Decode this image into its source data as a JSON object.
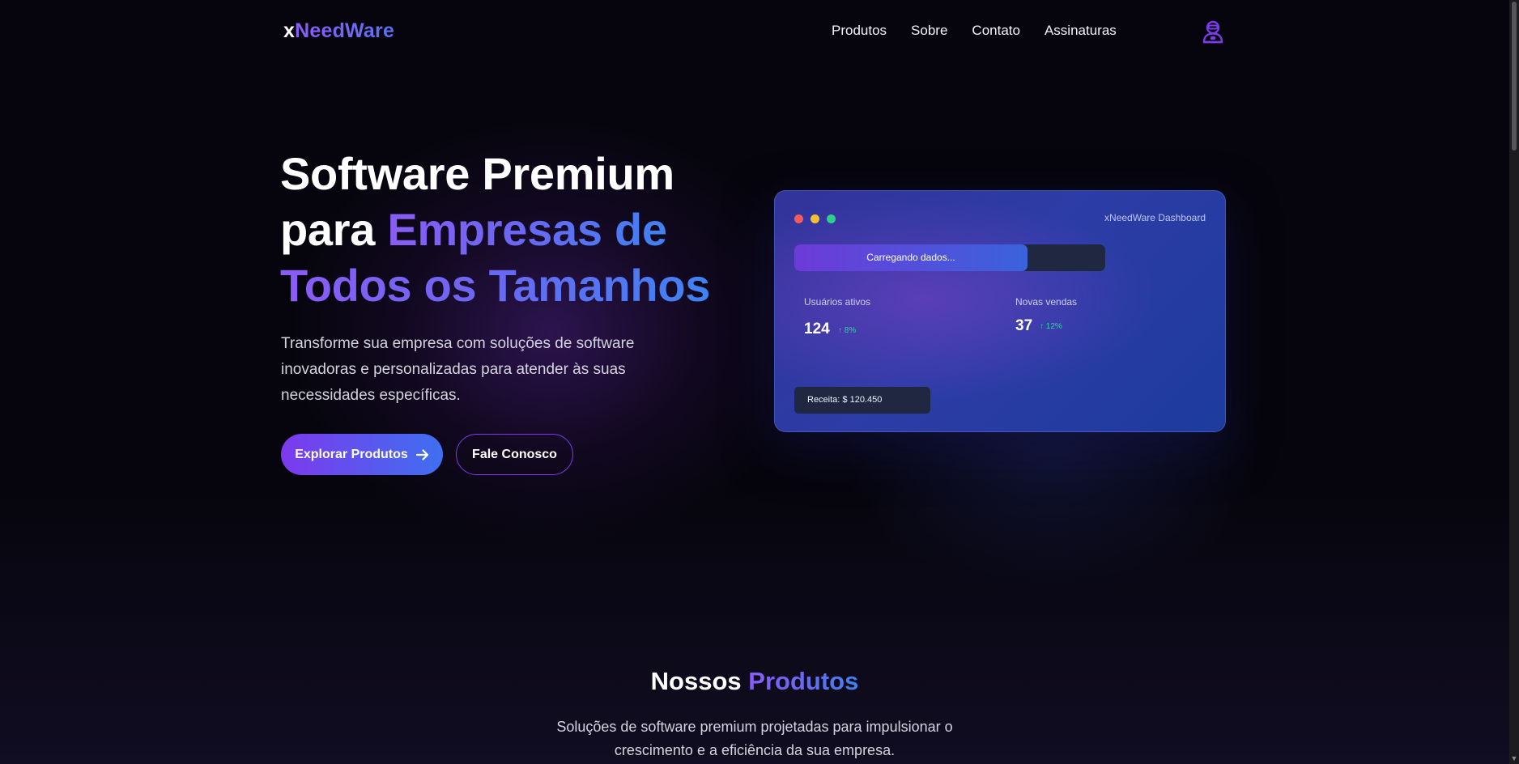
{
  "header": {
    "logo_x": "x",
    "logo_rest": "NeedWare",
    "nav": [
      "Produtos",
      "Sobre",
      "Contato",
      "Assinaturas"
    ],
    "user_icon": "user-avatar-icon"
  },
  "hero": {
    "title_line1": "Software Premium",
    "title_line2_plain": "para ",
    "title_line2_grad": "Empresas de",
    "title_line3_grad": "Todos os Tamanhos",
    "subtitle": "Transforme sua empresa com soluções de software inovadoras e personalizadas para atender às suas necessidades específicas.",
    "btn_primary": "Explorar Produtos",
    "btn_primary_icon": "arrow-right-icon",
    "btn_secondary": "Fale Conosco"
  },
  "dashboard": {
    "title": "xNeedWare Dashboard",
    "progress_text": "Carregando dados...",
    "progress_fraction": 0.75,
    "stat1_label": "Usuários ativos",
    "stat1_value": "124",
    "stat1_delta": "↑ 8%",
    "stat2_label": "Novas vendas",
    "stat2_value": "37",
    "stat2_delta": "↑ 12%",
    "revenue": "Receita: $ 120.450"
  },
  "products": {
    "title_plain": "Nossos ",
    "title_grad": "Produtos",
    "subtitle": "Soluções de software premium projetadas para impulsionar o crescimento e a eficiência da sua empresa."
  },
  "colors": {
    "background": "#06050d",
    "accent_purple": "#7c3aed",
    "accent_blue": "#3f6ff0",
    "delta_green": "#34d399"
  }
}
